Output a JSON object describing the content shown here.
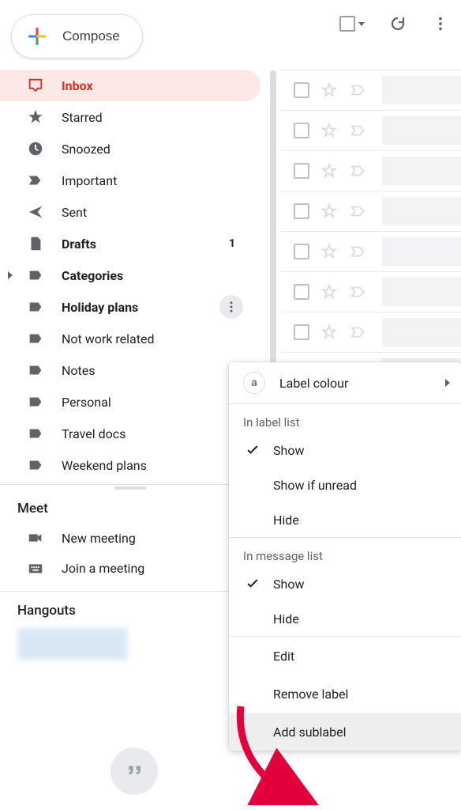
{
  "compose": {
    "label": "Compose"
  },
  "sidebar": {
    "items": [
      {
        "label": "Inbox",
        "icon": "inbox",
        "active": true,
        "bold": true
      },
      {
        "label": "Starred",
        "icon": "star",
        "active": false,
        "bold": false
      },
      {
        "label": "Snoozed",
        "icon": "clock",
        "active": false,
        "bold": false
      },
      {
        "label": "Important",
        "icon": "important",
        "active": false,
        "bold": false
      },
      {
        "label": "Sent",
        "icon": "sent",
        "active": false,
        "bold": false
      },
      {
        "label": "Drafts",
        "icon": "drafts",
        "active": false,
        "bold": true,
        "count": "1"
      },
      {
        "label": "Categories",
        "icon": "label",
        "active": false,
        "bold": true,
        "caret": true
      },
      {
        "label": "Holiday plans",
        "icon": "label",
        "active": false,
        "bold": true,
        "more": true
      },
      {
        "label": "Not work related",
        "icon": "label",
        "active": false,
        "bold": false
      },
      {
        "label": "Notes",
        "icon": "label",
        "active": false,
        "bold": false
      },
      {
        "label": "Personal",
        "icon": "label",
        "active": false,
        "bold": false
      },
      {
        "label": "Travel docs",
        "icon": "label",
        "active": false,
        "bold": false
      },
      {
        "label": "Weekend plans",
        "icon": "label",
        "active": false,
        "bold": false
      }
    ]
  },
  "meet": {
    "title": "Meet",
    "items": [
      {
        "label": "New meeting",
        "icon": "video"
      },
      {
        "label": "Join a meeting",
        "icon": "keyboard"
      }
    ]
  },
  "hangouts": {
    "title": "Hangouts"
  },
  "context_menu": {
    "label_colour": "Label colour",
    "in_label_list": "In label list",
    "in_message_list": "In message list",
    "options_label": [
      {
        "label": "Show",
        "checked": true
      },
      {
        "label": "Show if unread",
        "checked": false
      },
      {
        "label": "Hide",
        "checked": false
      }
    ],
    "options_message": [
      {
        "label": "Show",
        "checked": true
      },
      {
        "label": "Hide",
        "checked": false
      }
    ],
    "actions": [
      {
        "label": "Edit"
      },
      {
        "label": "Remove label"
      },
      {
        "label": "Add sublabel",
        "hover": true
      }
    ]
  },
  "message_rows": 8
}
